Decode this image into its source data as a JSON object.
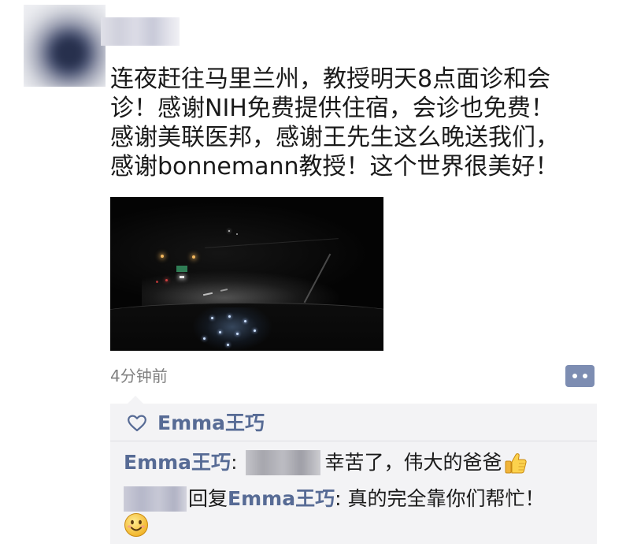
{
  "post": {
    "lines": [
      "连夜赶往马里兰州，教授明天8点面诊和会",
      "诊！感谢NIH免费提供住宿，会诊也免费！",
      "感谢美联医邦，感谢王先生这么晚送我们，",
      "感谢bonnemann教授！这个世界很美好！"
    ],
    "avatar_icon": "avatar",
    "photo_icon": "night-highway-photo"
  },
  "meta": {
    "time": "4分钟前",
    "comment_icon": "comment-icon"
  },
  "likes": {
    "icon": "heart-icon",
    "name": "Emma王巧"
  },
  "comments": [
    {
      "author": "Emma王巧",
      "separator": ":",
      "text": "幸苦了，伟大的爸爸",
      "emoji": "thumbs-up-icon"
    },
    {
      "reply_label": "回复",
      "reply_to": "Emma王巧",
      "text": ": 真的完全靠你们帮忙！",
      "emoji": "smile-icon"
    }
  ],
  "colors": {
    "link": "#576b95",
    "text": "#1a1a1a",
    "muted": "#808080",
    "panel": "#f3f3f5",
    "action": "#7d8db2"
  }
}
